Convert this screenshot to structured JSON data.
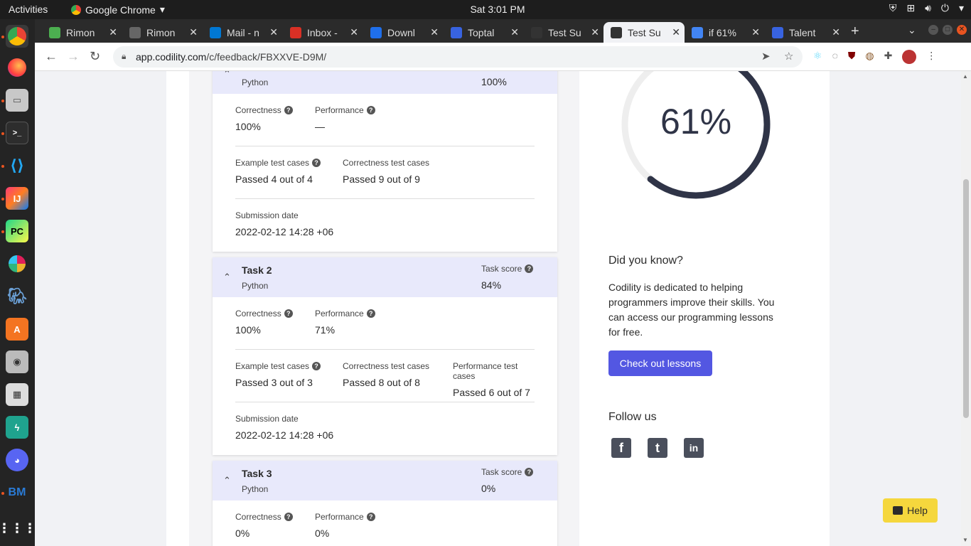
{
  "os": {
    "activities": "Activities",
    "app_name": "Google Chrome",
    "clock": "Sat  3:01 PM"
  },
  "browser": {
    "tabs": [
      {
        "label": "Rimon",
        "color": "#4caf50"
      },
      {
        "label": "Rimon",
        "color": "#666666"
      },
      {
        "label": "Mail - n",
        "color": "#0078d4"
      },
      {
        "label": "Inbox -",
        "color": "#d93025"
      },
      {
        "label": "Downl",
        "color": "#1f6feb"
      },
      {
        "label": "Toptal",
        "color": "#3863e0"
      },
      {
        "label": "Test Su",
        "color": "#333333"
      },
      {
        "label": "Test Su",
        "color": "#333333"
      },
      {
        "label": "if 61%",
        "color": "#4285f4"
      },
      {
        "label": "Talent",
        "color": "#3863e0"
      }
    ],
    "url_domain": "app.codility.com",
    "url_path": "/c/feedback/FBXXVE-D9M/"
  },
  "tasks": [
    {
      "name": "",
      "language": "Python",
      "score_label": "",
      "score": "100%",
      "correctness_label": "Correctness",
      "correctness": "100%",
      "performance_label": "Performance",
      "performance": "—",
      "example_label": "Example test cases",
      "example": "Passed 4 out of 4",
      "correctness_tests_label": "Correctness test cases",
      "correctness_tests": "Passed 9 out of 9",
      "submission_label": "Submission date",
      "submission": "2022-02-12 14:28 +06"
    },
    {
      "name": "Task 2",
      "language": "Python",
      "score_label": "Task score",
      "score": "84%",
      "correctness_label": "Correctness",
      "correctness": "100%",
      "performance_label": "Performance",
      "performance": "71%",
      "example_label": "Example test cases",
      "example": "Passed 3 out of 3",
      "correctness_tests_label": "Correctness test cases",
      "correctness_tests": "Passed 8 out of 8",
      "performance_tests_label": "Performance test cases",
      "performance_tests": "Passed 6 out of 7",
      "submission_label": "Submission date",
      "submission": "2022-02-12 14:28 +06"
    },
    {
      "name": "Task 3",
      "language": "Python",
      "score_label": "Task score",
      "score": "0%",
      "correctness_label": "Correctness",
      "correctness": "0%",
      "performance_label": "Performance",
      "performance": "0%"
    }
  ],
  "summary": {
    "score_text": "61%",
    "score_fraction": 0.61,
    "ring_color": "#2f3447",
    "track_color": "#eeeeee"
  },
  "did_you_know": {
    "title": "Did you know?",
    "body": "Codility is dedicated to helping programmers improve their skills. You can access our programming lessons for free.",
    "button": "Check out lessons"
  },
  "follow": {
    "title": "Follow us",
    "facebook": "f",
    "twitter": "t",
    "linkedin": "in"
  },
  "help": "Help"
}
